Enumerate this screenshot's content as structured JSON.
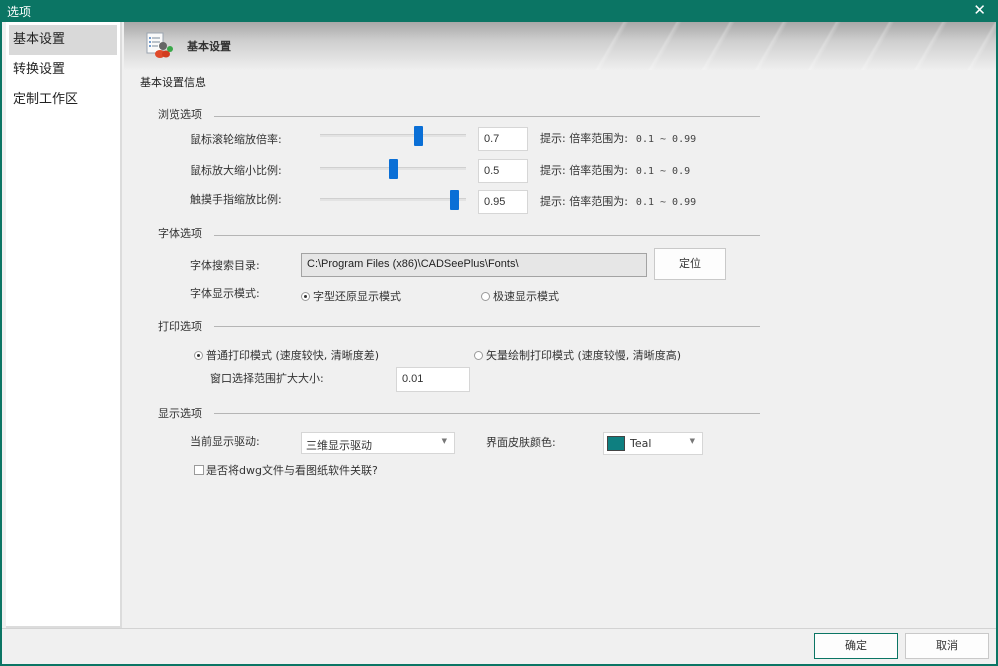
{
  "window": {
    "title": "选项",
    "close_icon": "close-icon"
  },
  "sidebar": {
    "items": [
      {
        "label": "基本设置",
        "active": true
      },
      {
        "label": "转换设置",
        "active": false
      },
      {
        "label": "定制工作区",
        "active": false
      }
    ]
  },
  "banner": {
    "title": "基本设置",
    "icon": "settings-users-icon"
  },
  "info_title": "基本设置信息",
  "browse": {
    "title": "浏览选项",
    "rows": [
      {
        "label": "鼠标滚轮缩放倍率:",
        "value": "0.7",
        "slider_fraction": 0.67,
        "hint": "提示: 倍率范围为:",
        "range": "0.1 ~ 0.99"
      },
      {
        "label": "鼠标放大缩小比例:",
        "value": "0.5",
        "slider_fraction": 0.5,
        "hint": "提示: 倍率范围为:",
        "range": "0.1 ~ 0.9"
      },
      {
        "label": "触摸手指缩放比例:",
        "value": "0.95",
        "slider_fraction": 0.92,
        "hint": "提示: 倍率范围为:",
        "range": "0.1 ~ 0.99"
      }
    ]
  },
  "font": {
    "title": "字体选项",
    "dir_label": "字体搜索目录:",
    "dir_value": "C:\\Program Files (x86)\\CADSeePlus\\Fonts\\",
    "locate_button": "定位",
    "mode_label": "字体显示模式:",
    "modes": [
      {
        "label": "字型还原显示模式",
        "selected": true
      },
      {
        "label": "极速显示模式",
        "selected": false
      }
    ]
  },
  "print": {
    "title": "打印选项",
    "modes": [
      {
        "label": "普通打印模式 (速度较快, 清晰度差)",
        "selected": true
      },
      {
        "label": "矢量绘制打印模式 (速度较慢, 清晰度高)",
        "selected": false
      }
    ],
    "expand_label": "窗口选择范围扩大大小:",
    "expand_value": "0.01"
  },
  "display": {
    "title": "显示选项",
    "driver_label": "当前显示驱动:",
    "driver_value": "三维显示驱动",
    "skin_label": "界面皮肤颜色:",
    "skin_value": "Teal",
    "skin_color": "#0e7f80",
    "associate_label": "是否将dwg文件与看图纸软件关联?",
    "associate_checked": false
  },
  "footer": {
    "ok_label": "确定",
    "cancel_label": "取消"
  }
}
